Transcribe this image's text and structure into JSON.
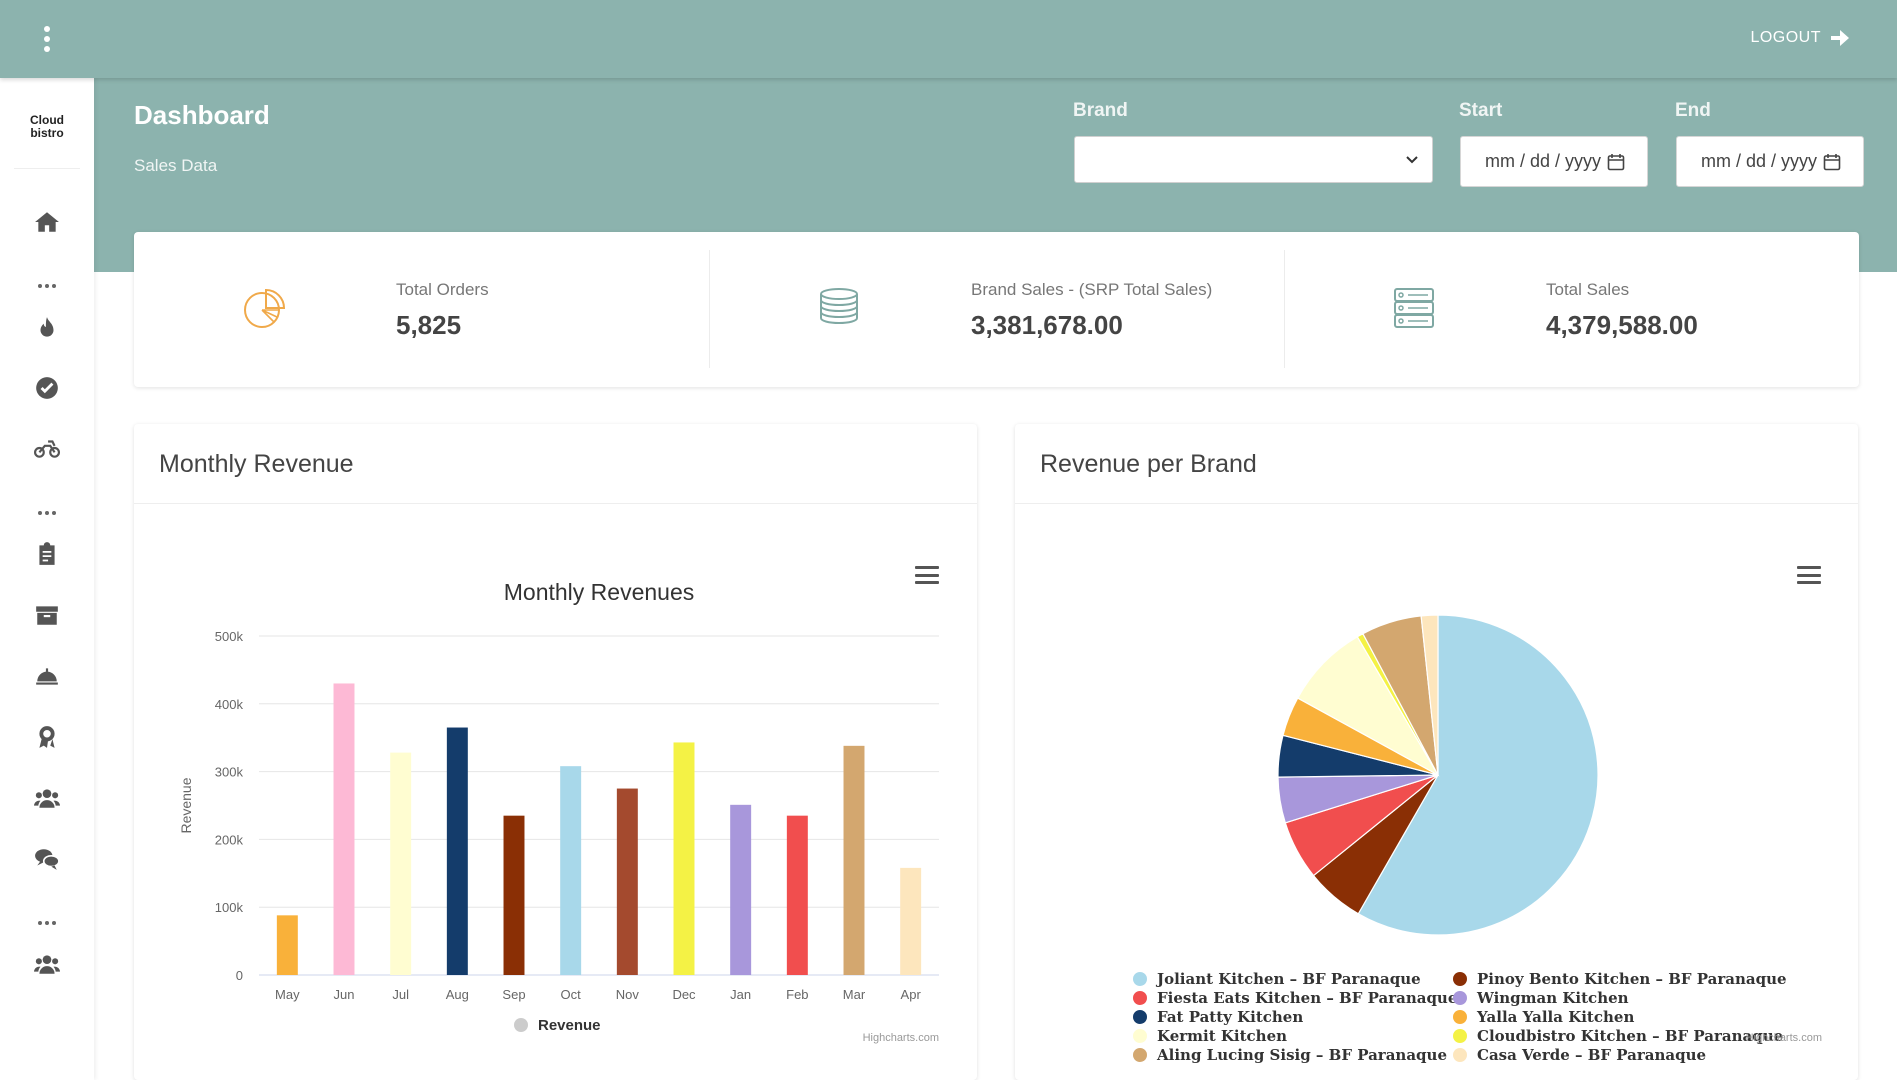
{
  "topbar": {
    "logout_label": "LOGOUT"
  },
  "sidebar": {
    "logo_line1": "Cloud",
    "logo_line2": "bistro",
    "items": [
      "home-icon",
      "fire-icon",
      "check-circle-icon",
      "motorcycle-icon",
      "clipboard-icon",
      "box-icon",
      "service-bell-icon",
      "award-icon",
      "users-icon",
      "chat-icon",
      "team-icon"
    ]
  },
  "header": {
    "title": "Dashboard",
    "subtitle": "Sales Data"
  },
  "filters": {
    "brand_label": "Brand",
    "brand_value": "",
    "start_label": "Start",
    "start_placeholder": "mm / dd / yyyy",
    "end_label": "End",
    "end_placeholder": "mm / dd / yyyy"
  },
  "stats": [
    {
      "label": "Total Orders",
      "value": "5,825",
      "icon": "pie-chart-icon",
      "color": "#f0a94a"
    },
    {
      "label": "Brand Sales - (SRP Total Sales)",
      "value": "3,381,678.00",
      "icon": "coins-icon",
      "color": "#7fa8a3"
    },
    {
      "label": "Total Sales",
      "value": "4,379,588.00",
      "icon": "server-icon",
      "color": "#7fa8a3"
    }
  ],
  "monthly_card": {
    "title": "Monthly Revenue",
    "credits": "Highcharts.com"
  },
  "brand_card": {
    "title": "Revenue per Brand",
    "credits": "Highcharts.com"
  },
  "chart_data": [
    {
      "type": "bar",
      "title": "Monthly Revenues",
      "ylabel": "Revenue",
      "xlabel": "",
      "categories": [
        "May",
        "Jun",
        "Jul",
        "Aug",
        "Sep",
        "Oct",
        "Nov",
        "Dec",
        "Jan",
        "Feb",
        "Mar",
        "Apr"
      ],
      "series": [
        {
          "name": "Revenue",
          "values": [
            88000,
            430000,
            328000,
            365000,
            235000,
            308000,
            275000,
            343000,
            251000,
            235000,
            338000,
            158000
          ]
        }
      ],
      "colors": [
        "#f9b13a",
        "#fdb9d5",
        "#fffdd1",
        "#143c6b",
        "#8a2f05",
        "#a8d8ea",
        "#a44a2e",
        "#f4f245",
        "#a897db",
        "#f14e4e",
        "#d3a76f",
        "#fde6bd"
      ],
      "ylim": [
        0,
        500000
      ],
      "yticks": [
        "0",
        "100k",
        "200k",
        "300k",
        "400k",
        "500k"
      ],
      "grid": true,
      "legend": "bottom",
      "legend_color": "#cccccc"
    },
    {
      "type": "pie",
      "labels": [
        "Joliant Kitchen – BF Paranaque",
        "Pinoy Bento Kitchen – BF Paranaque",
        "Fiesta Eats Kitchen – BF Paranaque",
        "Wingman Kitchen",
        "Fat Patty Kitchen",
        "Yalla Yalla Kitchen",
        "Kermit Kitchen",
        "Cloudbistro Kitchen – BF Paranaque",
        "Aling Lucing Sisig – BF Paranaque",
        "Casa Verde – BF Paranaque"
      ],
      "values": [
        55.5,
        5.6,
        5.7,
        4.4,
        4.0,
        3.8,
        8.2,
        0.6,
        5.8,
        1.6
      ],
      "colors": [
        "#a8d8ea",
        "#8a2f05",
        "#f14e4e",
        "#a897db",
        "#143c6b",
        "#f9b13a",
        "#fffdd1",
        "#f4f245",
        "#d3a76f",
        "#fde6bd"
      ],
      "legend": "bottom"
    }
  ]
}
